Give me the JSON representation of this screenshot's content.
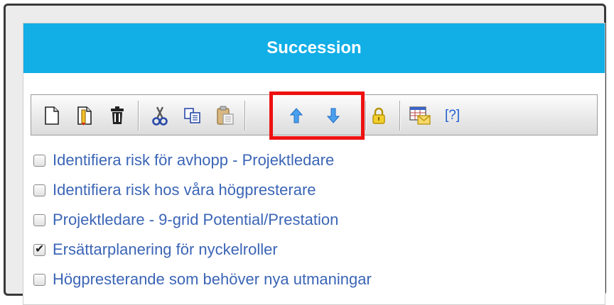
{
  "header": {
    "title": "Succession"
  },
  "toolbar": {
    "buttons": [
      {
        "icon": "new-document-icon"
      },
      {
        "icon": "edit-document-icon"
      },
      {
        "icon": "trash-icon"
      },
      {
        "icon": "cut-icon"
      },
      {
        "icon": "copy-icon"
      },
      {
        "icon": "paste-icon"
      },
      {
        "icon": "arrow-up-icon"
      },
      {
        "icon": "arrow-down-icon"
      },
      {
        "icon": "lock-icon"
      },
      {
        "icon": "email-calendar-icon"
      }
    ],
    "help_label": "[?]"
  },
  "items": [
    {
      "label": "Identifiera risk för avhopp - Projektledare",
      "checked": false
    },
    {
      "label": "Identifiera risk hos våra högpresterare",
      "checked": false
    },
    {
      "label": "Projektledare - 9-grid Potential/Prestation",
      "checked": false
    },
    {
      "label": "Ersättarplanering för nyckelroller",
      "checked": true
    },
    {
      "label": "Högpresterande som behöver nya utmaningar",
      "checked": false
    }
  ],
  "colors": {
    "header": "#12aee6",
    "link": "#3b65b6",
    "highlight": "#ee1111"
  },
  "checkmark": "✔"
}
